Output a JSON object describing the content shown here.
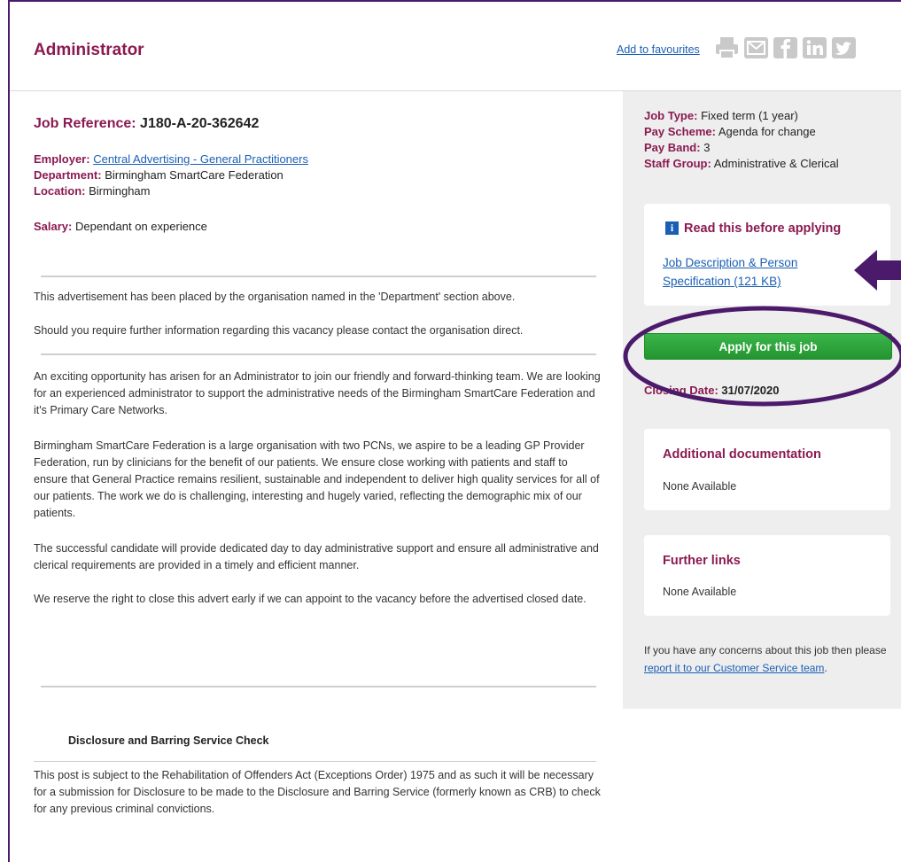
{
  "header": {
    "title": "Administrator",
    "favourites_label": "Add to favourites",
    "share_icons": [
      "print-icon",
      "email-icon",
      "facebook-icon",
      "linkedin-icon",
      "twitter-icon"
    ]
  },
  "job": {
    "ref_label": "Job Reference:",
    "ref_value": "J180-A-20-362642",
    "employer_label": "Employer:",
    "employer_value": "Central Advertising - General Practitioners",
    "department_label": "Department:",
    "department_value": "Birmingham SmartCare Federation",
    "location_label": "Location:",
    "location_value": "Birmingham",
    "salary_label": "Salary:",
    "salary_value": "Dependant on experience"
  },
  "notices": [
    "This advertisement has been placed by the organisation named in the 'Department' section above.",
    "Should you require further information regarding this vacancy please contact the organisation direct."
  ],
  "description": [
    "An exciting opportunity has arisen for an Administrator to join our friendly and forward-thinking team. We are looking for an experienced administrator to support the administrative needs of the Birmingham SmartCare Federation and it's Primary Care Networks.",
    "Birmingham SmartCare Federation is a large organisation with two PCNs, we aspire to be a leading GP Provider Federation, run by clinicians for the benefit of our patients. We ensure close working with patients and staff to ensure that General Practice remains resilient, sustainable and independent to deliver high quality services for all of our patients. The work we do is challenging, interesting and hugely varied, reflecting the demographic mix of our patients.",
    "The successful candidate will provide dedicated day to day administrative support and ensure all administrative and clerical requirements are provided in a timely and efficient manner.",
    "We reserve the right to close this advert early if we can appoint to the vacancy before the advertised closed date."
  ],
  "dbs": {
    "title": "Disclosure and Barring Service Check",
    "text": "This post is subject to the Rehabilitation of Offenders Act (Exceptions Order) 1975 and as such it will be necessary for a submission for Disclosure to be made to the Disclosure and Barring Service (formerly known as CRB) to check for any previous criminal convictions."
  },
  "sidebar": {
    "job_type_label": "Job Type:",
    "job_type_value": "Fixed term (1 year)",
    "pay_scheme_label": "Pay Scheme:",
    "pay_scheme_value": "Agenda for change",
    "pay_band_label": "Pay Band:",
    "pay_band_value": "3",
    "staff_group_label": "Staff Group:",
    "staff_group_value": "Administrative & Clerical",
    "read_before_title": "Read this before applying",
    "doc_link": "Job Description & Person Specification (121 KB)",
    "apply_label": "Apply for this job",
    "closing_label": "Closing Date:",
    "closing_value": "31/07/2020",
    "additional_docs_title": "Additional documentation",
    "additional_docs_text": "None Available",
    "further_links_title": "Further links",
    "further_links_text": "None Available",
    "concern_text": "If you have any concerns about this job then please",
    "concern_link": "report it to our Customer Service team",
    "concern_end": "."
  },
  "colors": {
    "brand": "#8b1a52",
    "link": "#1a5fb4",
    "apply": "#2ea83b",
    "annotation": "#4b1a6b"
  }
}
